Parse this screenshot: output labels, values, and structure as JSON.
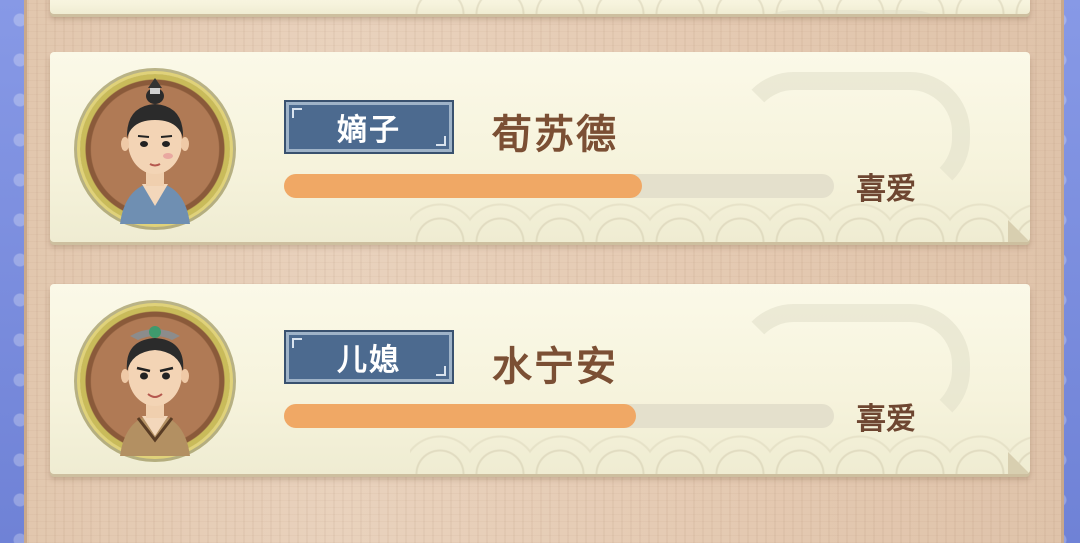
{
  "members": [
    {
      "title": "嫡子",
      "name": "荀苏德",
      "affinity_progress": 0.65,
      "status": "喜爱",
      "avatar_icon": "noble-youth-portrait-icon"
    },
    {
      "title": "儿媳",
      "name": "水宁安",
      "affinity_progress": 0.64,
      "status": "喜爱",
      "avatar_icon": "young-woman-portrait-icon"
    }
  ],
  "colors": {
    "badge": "#4c6a8f",
    "bar_fill": "#f0a865",
    "bar_track": "#e4e0cc",
    "name_text": "#7b4f34"
  }
}
